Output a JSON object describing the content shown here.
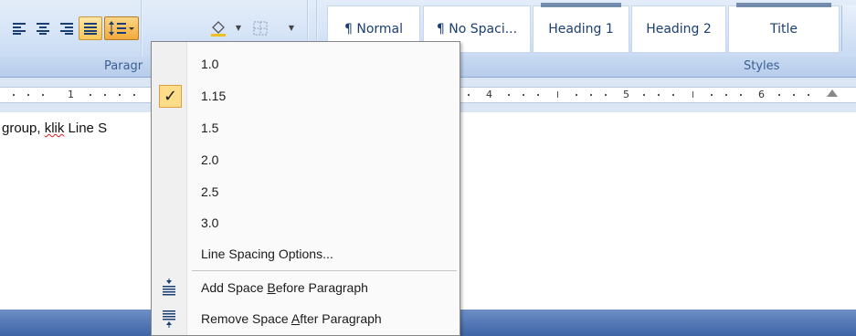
{
  "ribbon": {
    "paragraph_group_label": "Paragr",
    "styles_group_label": "Styles",
    "styles": [
      "¶ Normal",
      "¶ No Spaci...",
      "Heading 1",
      "Heading 2",
      "Title"
    ]
  },
  "ruler": {
    "numbers": [
      "1",
      "4",
      "5",
      "6"
    ]
  },
  "document": {
    "text_before": "group, ",
    "text_misspelled": "klik",
    "text_after": " Line S"
  },
  "line_spacing_menu": {
    "options": [
      "1.0",
      "1.15",
      "1.5",
      "2.0",
      "2.5",
      "3.0"
    ],
    "selected": "1.15",
    "check_glyph": "✓",
    "options_label": "Line Spacing Options...",
    "add_before": {
      "pre": "Add Space ",
      "accel": "B",
      "post": "efore Paragraph"
    },
    "remove_after": {
      "pre": "Remove Space ",
      "accel": "A",
      "post": "fter Paragraph"
    }
  },
  "colors": {
    "ribbon_text": "#15428b",
    "highlight": "#fddc8a",
    "bottom_bar": "#3e64a6"
  }
}
